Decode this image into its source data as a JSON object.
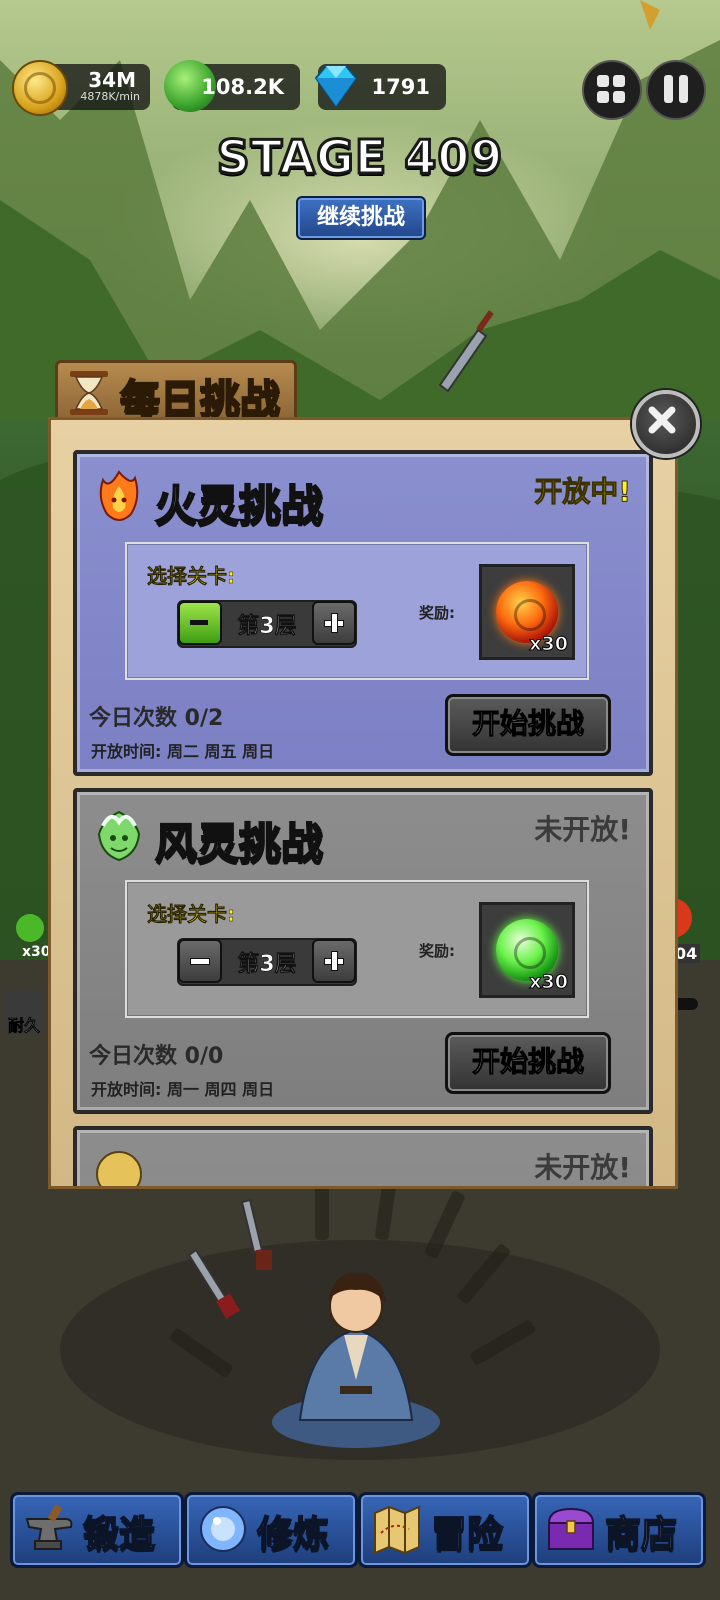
{
  "resources": {
    "coins": "34M",
    "coin_rate": "4878K/min",
    "jade": "108.2K",
    "gems": "1791"
  },
  "stage": {
    "title": "STAGE 409",
    "continue_label": "继续挑战"
  },
  "daily": {
    "title": "每日挑战",
    "cards": [
      {
        "name": "火灵挑战",
        "status": "开放中!",
        "select_label": "选择关卡:",
        "level": "第3层",
        "reward_label": "奖励:",
        "reward_qty": "x30",
        "count": "今日次数 0/2",
        "open_time": "开放时间: 周二 周五 周日",
        "start_label": "开始挑战"
      },
      {
        "name": "风灵挑战",
        "status": "未开放!",
        "select_label": "选择关卡:",
        "level": "第3层",
        "reward_label": "奖励:",
        "reward_qty": "x30",
        "count": "今日次数 0/0",
        "open_time": "开放时间: 周一 周四 周日",
        "start_label": "开始挑战"
      },
      {
        "status": "未开放!"
      }
    ]
  },
  "side": {
    "left_qty": "x30",
    "durability": "耐久",
    "right_num": "04"
  },
  "nav": [
    {
      "label": "锻造",
      "icon": "anvil-icon"
    },
    {
      "label": "修炼",
      "icon": "orb-icon"
    },
    {
      "label": "冒险",
      "icon": "map-icon"
    },
    {
      "label": "商店",
      "icon": "chest-icon"
    }
  ],
  "colors": {
    "open_status": "#ffef2e",
    "closed_status": "#3b3b3b",
    "nav_blue": "#2a529c"
  }
}
